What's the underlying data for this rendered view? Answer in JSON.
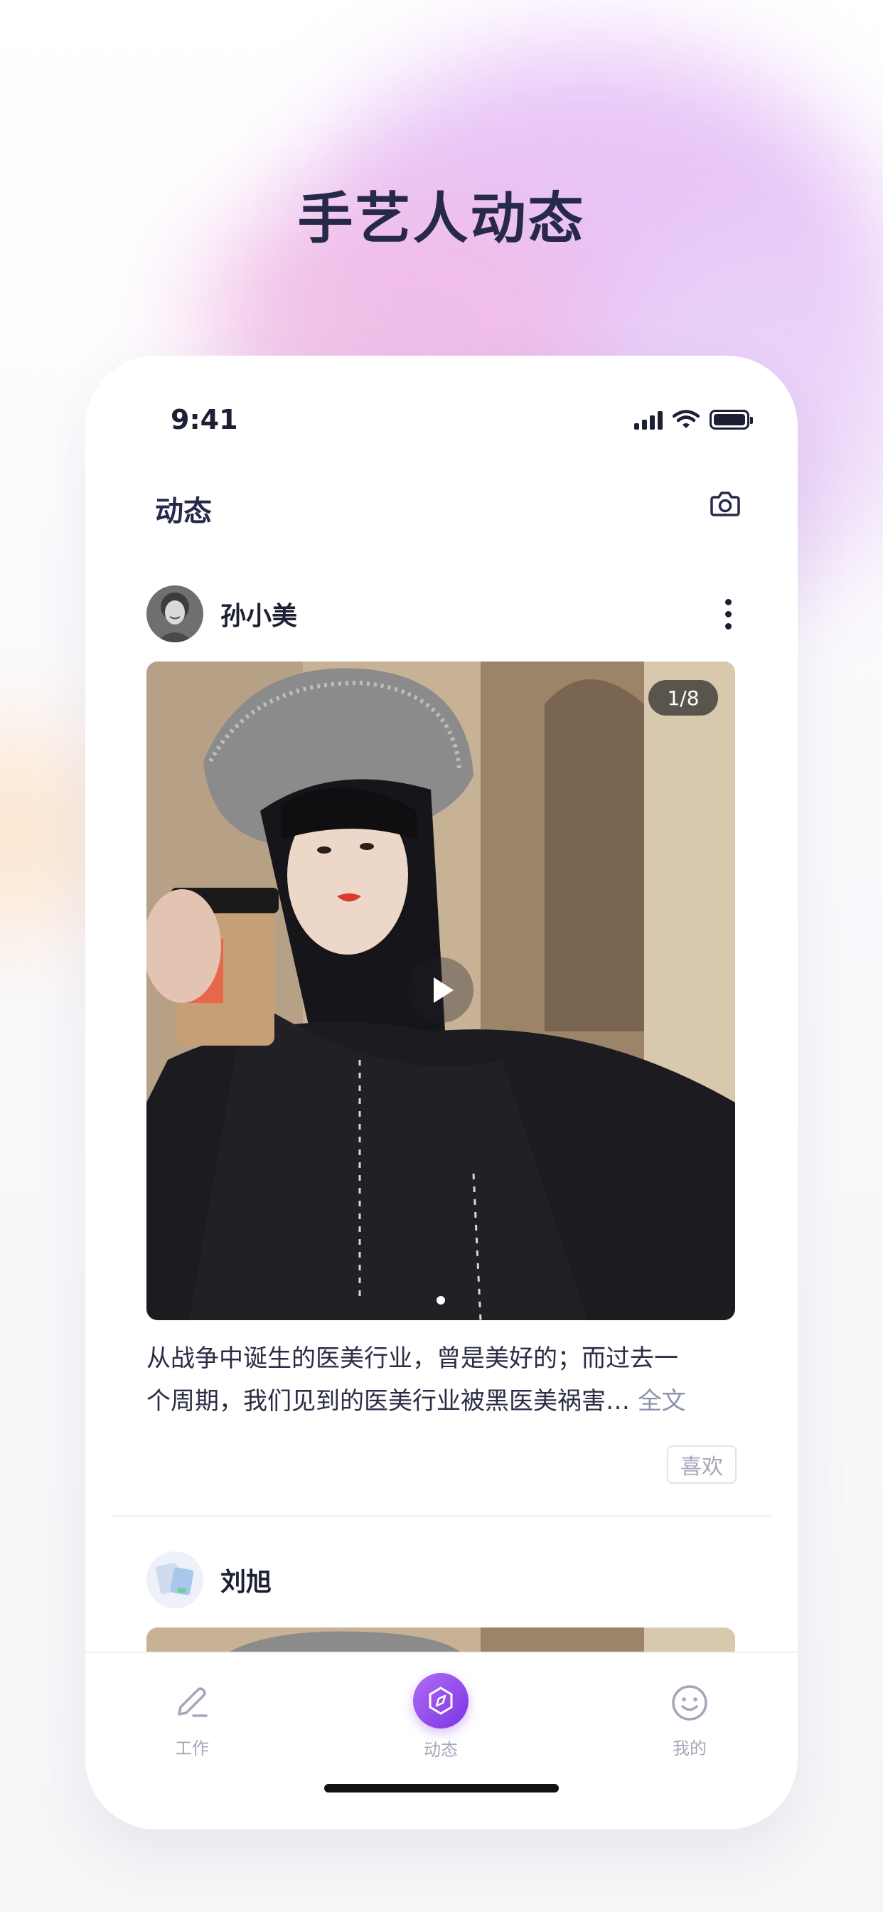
{
  "headline": "手艺人动态",
  "status_bar": {
    "time": "9:41"
  },
  "nav": {
    "title": "动态",
    "camera_icon": "camera-icon"
  },
  "post": {
    "username": "孙小美",
    "media_counter": "1/8",
    "caption_line1": "从战争中诞生的医美行业，曾是美好的；而过去一",
    "caption_line2": "个周期，我们见到的医美行业被黑医美祸害…",
    "read_more": "全文",
    "like_label": "喜欢"
  },
  "post2": {
    "username": "刘旭",
    "media_counter": ""
  },
  "tab_bar": {
    "tabs": [
      {
        "label": "工作",
        "icon": "pencil-icon"
      },
      {
        "label": "动态",
        "icon": "compass-icon",
        "active": true
      },
      {
        "label": "我的",
        "icon": "smile-icon"
      }
    ]
  },
  "colors": {
    "accent": "#8a45ec",
    "title": "#27294b",
    "muted": "#a4a7b8"
  }
}
